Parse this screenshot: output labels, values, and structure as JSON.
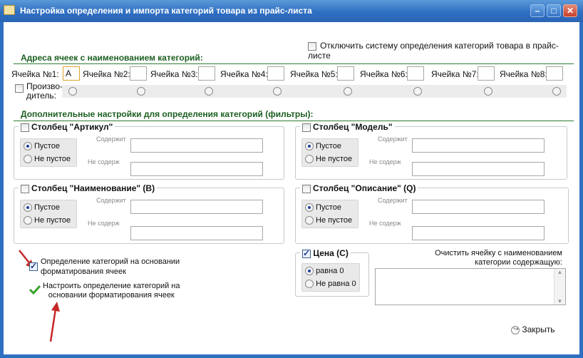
{
  "window": {
    "title": "Настройка определения и импорта категорий товара из прайс-листа",
    "minimize_symbol": "–",
    "maximize_symbol": "□",
    "close_symbol": "✕"
  },
  "disable_system": {
    "label": "Отключить систему определения категорий товара в прайс-листе",
    "checked": false
  },
  "addresses": {
    "title": "Адреса ячеек с наименованием категорий:",
    "cells": [
      {
        "label": "Ячейка №1:",
        "value": "A"
      },
      {
        "label": "Ячейка №2:",
        "value": ""
      },
      {
        "label": "Ячейка №3:",
        "value": ""
      },
      {
        "label": "Ячейка №4:",
        "value": ""
      },
      {
        "label": "Ячейка №5:",
        "value": ""
      },
      {
        "label": "Ячейка №6:",
        "value": ""
      },
      {
        "label": "Ячейка №7:",
        "value": ""
      },
      {
        "label": "Ячейка №8:",
        "value": ""
      }
    ],
    "manufacturer_line1": "Произво-",
    "manufacturer_line2": "дитель:"
  },
  "filters": {
    "title": "Дополнительные настройки для определения категорий (фильтры):",
    "contains_label": "Содержит",
    "not_contains_label": "Не содерж",
    "empty_label": "Пустое",
    "not_empty_label": "Не пустое",
    "groups": [
      {
        "title": "Столбец \"Артикул\"",
        "checked": false,
        "selected": "empty"
      },
      {
        "title": "Столбец \"Модель\"",
        "checked": false,
        "selected": "empty"
      },
      {
        "title": "Столбец \"Наименование\" (B)",
        "checked": false,
        "selected": "empty"
      },
      {
        "title": "Столбец \"Описание\" (Q)",
        "checked": false,
        "selected": "empty"
      }
    ]
  },
  "format_detection": {
    "label_line1": "Определение категорий на основании",
    "label_line2": "форматирования ячеек",
    "checked": true
  },
  "configure_format": {
    "label_line1": "Настроить определение категорий на",
    "label_line2": "основании форматирования ячеек",
    "icon": "green-checkmark-icon"
  },
  "price": {
    "title": "Цена (C)",
    "checked": true,
    "zero_label": "равна 0",
    "nonzero_label": "Не равна 0",
    "selected": "zero"
  },
  "clear_cell": {
    "label_line1": "Очистить ячейку с наименованием",
    "label_line2": "категории содержащую:",
    "value": ""
  },
  "close_button": {
    "label": "Закрыть"
  },
  "colors": {
    "accent": "#2f6fc2",
    "section": "#1b5e20",
    "arrow": "#c62828"
  }
}
